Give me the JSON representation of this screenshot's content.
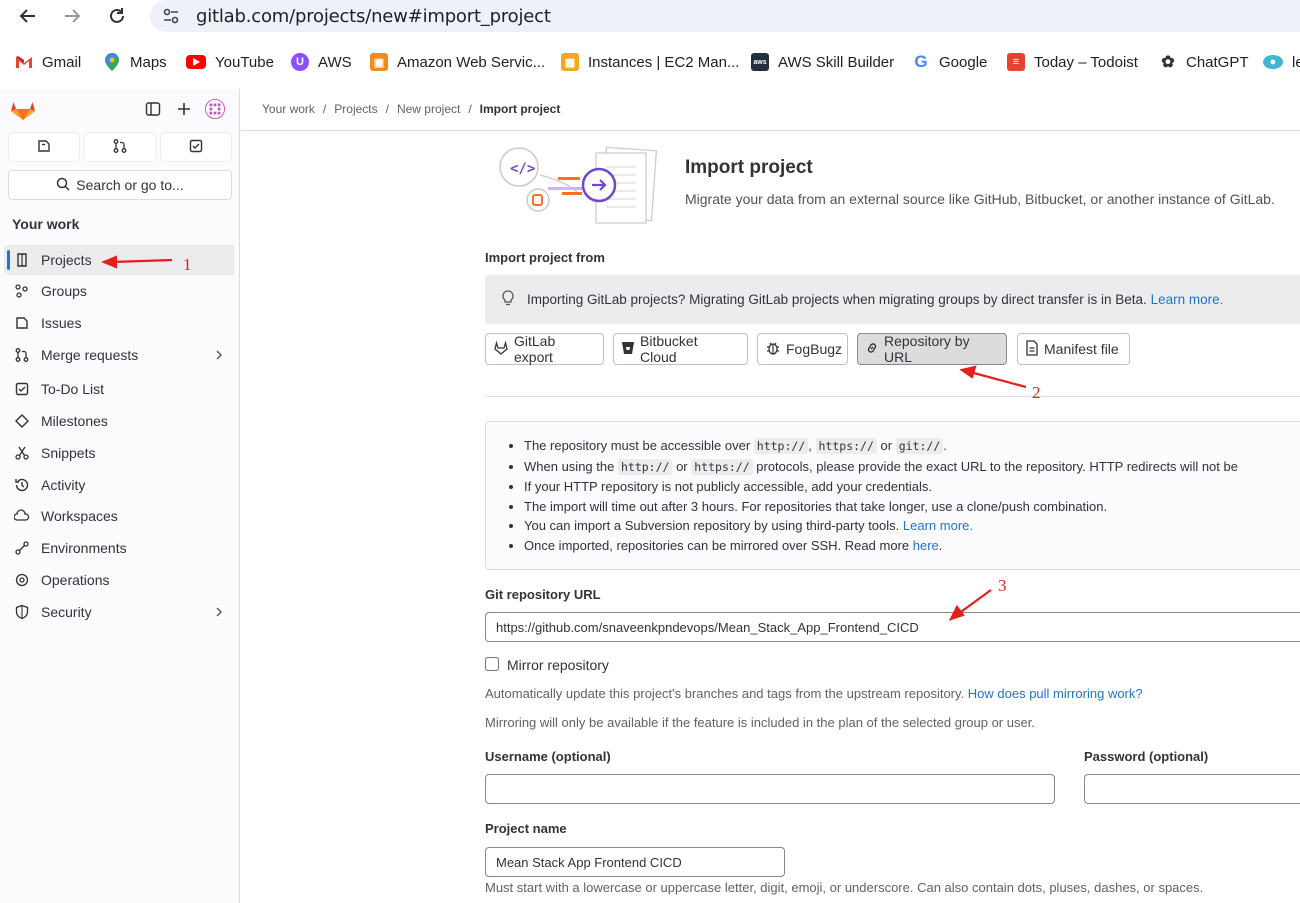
{
  "browser": {
    "url": "gitlab.com/projects/new#import_project",
    "bookmarks": [
      {
        "label": "Gmail",
        "icon": "gmail-icon"
      },
      {
        "label": "Maps",
        "icon": "maps-icon"
      },
      {
        "label": "YouTube",
        "icon": "youtube-icon"
      },
      {
        "label": "AWS",
        "icon": "aws-icon"
      },
      {
        "label": "Amazon Web Servic...",
        "icon": "aws-cube-icon"
      },
      {
        "label": "Instances | EC2 Man...",
        "icon": "ec2-icon"
      },
      {
        "label": "AWS Skill Builder",
        "icon": "aws-skill-icon"
      },
      {
        "label": "Google",
        "icon": "google-icon"
      },
      {
        "label": "Today – Todoist",
        "icon": "todoist-icon"
      },
      {
        "label": "ChatGPT",
        "icon": "chatgpt-icon"
      },
      {
        "label": "le",
        "icon": "cloud-icon"
      }
    ]
  },
  "sidebar": {
    "search_label": "Search or go to...",
    "section_title": "Your work",
    "items": [
      {
        "label": "Projects",
        "icon": "project-icon",
        "active": true
      },
      {
        "label": "Groups",
        "icon": "group-icon"
      },
      {
        "label": "Issues",
        "icon": "issues-icon"
      },
      {
        "label": "Merge requests",
        "icon": "merge-request-icon",
        "expandable": true
      },
      {
        "label": "To-Do List",
        "icon": "todo-icon"
      },
      {
        "label": "Milestones",
        "icon": "milestone-icon"
      },
      {
        "label": "Snippets",
        "icon": "snippet-icon"
      },
      {
        "label": "Activity",
        "icon": "history-icon"
      },
      {
        "label": "Workspaces",
        "icon": "workspace-icon"
      },
      {
        "label": "Environments",
        "icon": "environment-icon"
      },
      {
        "label": "Operations",
        "icon": "operations-icon"
      },
      {
        "label": "Security",
        "icon": "shield-icon",
        "expandable": true
      }
    ]
  },
  "breadcrumb": [
    "Your work",
    "Projects",
    "New project",
    "Import project"
  ],
  "page": {
    "title": "Import project",
    "description": "Migrate your data from an external source like GitHub, Bitbucket, or another instance of GitLab.",
    "import_from_label": "Import project from",
    "alert_text": "Importing GitLab projects? Migrating GitLab projects when migrating groups by direct transfer is in Beta.",
    "alert_link": "Learn more.",
    "sources": [
      {
        "label": "GitLab export",
        "icon": "tanuki-icon"
      },
      {
        "label": "Bitbucket Cloud",
        "icon": "bitbucket-icon"
      },
      {
        "label": "FogBugz",
        "icon": "bug-icon"
      },
      {
        "label": "Repository by URL",
        "icon": "link-icon",
        "selected": true
      },
      {
        "label": "Manifest file",
        "icon": "document-icon"
      }
    ],
    "notes": {
      "n1_a": "The repository must be accessible over",
      "n1_c1": "http://",
      "n1_sep": ",",
      "n1_c2": "https://",
      "n1_or": "or",
      "n1_c3": "git://",
      "n1_end": ".",
      "n2_a": "When using the",
      "n2_c1": "http://",
      "n2_or": "or",
      "n2_c2": "https://",
      "n2_end": "protocols, please provide the exact URL to the repository. HTTP redirects will not be",
      "n3": "If your HTTP repository is not publicly accessible, add your credentials.",
      "n4": "The import will time out after 3 hours. For repositories that take longer, use a clone/push combination.",
      "n5_a": "You can import a Subversion repository by using third-party tools.",
      "n5_link": "Learn more.",
      "n6_a": "Once imported, repositories can be mirrored over SSH. Read more",
      "n6_link": "here",
      "n6_end": "."
    },
    "git_url_label": "Git repository URL",
    "git_url_value": "https://github.com/snaveenkpndevops/Mean_Stack_App_Frontend_CICD",
    "mirror_label": "Mirror repository",
    "mirror_help": "Automatically update this project's branches and tags from the upstream repository.",
    "mirror_help_link": "How does pull mirroring work?",
    "mirror_note": "Mirroring will only be available if the feature is included in the plan of the selected group or user.",
    "username_label": "Username (optional)",
    "username_value": "",
    "password_label": "Password (optional)",
    "password_value": "",
    "project_name_label": "Project name",
    "project_name_value": "Mean Stack App Frontend CICD",
    "project_name_help": "Must start with a lowercase or uppercase letter, digit, emoji, or underscore. Can also contain dots, pluses, dashes, or spaces."
  },
  "annotations": [
    "1",
    "2",
    "3"
  ],
  "colors": {
    "annotation": "#e3201b",
    "link": "#1f75cb",
    "accent": "#6e49cb"
  }
}
